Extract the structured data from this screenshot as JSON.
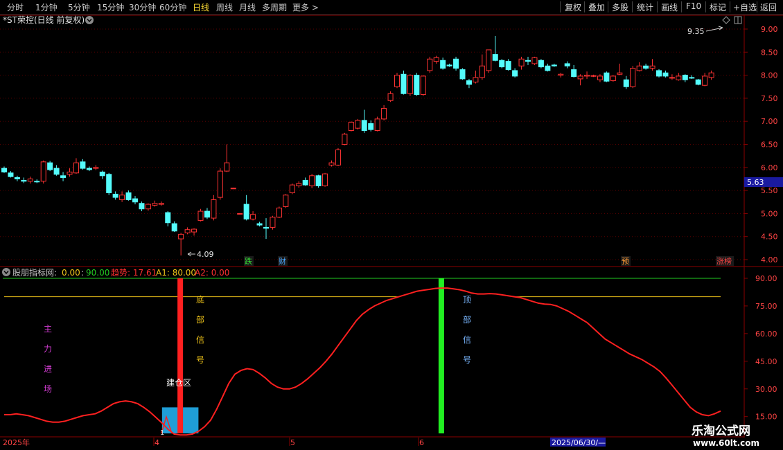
{
  "toolbar": {
    "periods": [
      "分时",
      "1分钟",
      "5分钟",
      "15分钟",
      "30分钟",
      "60分钟",
      "日线",
      "周线",
      "月线",
      "多周期",
      "更多 >"
    ],
    "active_period": "日线",
    "actions": [
      "复权",
      "叠加",
      "多股",
      "统计",
      "画线",
      "F10",
      "标记",
      "+自选",
      "返回"
    ]
  },
  "header": {
    "title": "*ST荣控(日线 前复权)",
    "icons": [
      "chevron-down-icon",
      "diamond-icon",
      "window-icon"
    ]
  },
  "price_axis": {
    "ticks": [
      "9.00",
      "8.50",
      "8.00",
      "7.50",
      "7.00",
      "6.50",
      "6.00",
      "5.50",
      "5.00",
      "4.50",
      "4.00"
    ],
    "current_price": "5.63",
    "high_label": "9.35",
    "low_label": "4.09"
  },
  "event_marks": [
    {
      "text": "跌",
      "color": "#33dd33"
    },
    {
      "text": "财",
      "color": "#4aa8ff"
    },
    {
      "text": "预",
      "color": "#ff9933"
    },
    {
      "text": "涨榜",
      "color": "#ff4444"
    }
  ],
  "indicator": {
    "name": "股朋指标网",
    "value_a": "0.00",
    "value_b": "90.00",
    "trend_label": "趋势: 17.61",
    "a1_label": "A1: 80.00",
    "a2_label": "A2: 0.00",
    "ticks": [
      "90.00",
      "75.00",
      "60.00",
      "45.00",
      "30.00",
      "15.00"
    ],
    "labels": {
      "main_entry": [
        "主",
        "力",
        "进",
        "场"
      ],
      "bottom_signal": [
        "底",
        "部",
        "信",
        "号"
      ],
      "top_signal": [
        "顶",
        "部",
        "信",
        "号"
      ],
      "build_zone": "建仓区",
      "small_mark": "1"
    }
  },
  "time_axis": {
    "labels": [
      "2025年",
      "4",
      "5",
      "6"
    ],
    "cursor_date": "2025/06/30/—"
  },
  "watermark": {
    "line1": "乐淘公式网",
    "line2": "www.60lt.com"
  },
  "colors": {
    "up": "#ff3333",
    "down": "#54fcfc",
    "trend_line": "#ff2020",
    "a1_line": "#f0c419",
    "upper_line": "#22cc22",
    "bottom_bar": "#ff2020",
    "top_bar": "#22ee22",
    "build_box": "#1f9ed6"
  },
  "chart_data": {
    "type": "candlestick",
    "price_ylim": [
      3.85,
      9.3
    ],
    "indicator_ylim": [
      4,
      96
    ],
    "candles": [
      {
        "o": 5.98,
        "h": 6.02,
        "l": 5.88,
        "c": 5.9
      },
      {
        "o": 5.88,
        "h": 5.92,
        "l": 5.78,
        "c": 5.8
      },
      {
        "o": 5.78,
        "h": 5.82,
        "l": 5.7,
        "c": 5.75
      },
      {
        "o": 5.72,
        "h": 5.78,
        "l": 5.66,
        "c": 5.7
      },
      {
        "o": 5.7,
        "h": 5.8,
        "l": 5.65,
        "c": 5.75
      },
      {
        "o": 5.7,
        "h": 5.74,
        "l": 5.66,
        "c": 5.69
      },
      {
        "o": 5.7,
        "h": 6.15,
        "l": 5.65,
        "c": 6.12
      },
      {
        "o": 6.1,
        "h": 6.14,
        "l": 5.92,
        "c": 5.95
      },
      {
        "o": 5.98,
        "h": 6.05,
        "l": 5.82,
        "c": 5.85
      },
      {
        "o": 5.82,
        "h": 5.9,
        "l": 5.7,
        "c": 5.78
      },
      {
        "o": 5.85,
        "h": 5.98,
        "l": 5.8,
        "c": 5.9
      },
      {
        "o": 5.88,
        "h": 6.2,
        "l": 5.86,
        "c": 6.1
      },
      {
        "o": 6.12,
        "h": 6.18,
        "l": 5.95,
        "c": 5.98
      },
      {
        "o": 5.98,
        "h": 6.02,
        "l": 5.92,
        "c": 5.95
      },
      {
        "o": 5.98,
        "h": 6.05,
        "l": 5.94,
        "c": 6.0
      },
      {
        "o": 5.9,
        "h": 5.93,
        "l": 5.75,
        "c": 5.82
      },
      {
        "o": 5.85,
        "h": 5.88,
        "l": 5.4,
        "c": 5.45
      },
      {
        "o": 5.42,
        "h": 5.48,
        "l": 5.3,
        "c": 5.35
      },
      {
        "o": 5.3,
        "h": 5.48,
        "l": 5.25,
        "c": 5.4
      },
      {
        "o": 5.45,
        "h": 5.5,
        "l": 5.28,
        "c": 5.3
      },
      {
        "o": 5.32,
        "h": 5.38,
        "l": 5.2,
        "c": 5.25
      },
      {
        "o": 5.22,
        "h": 5.26,
        "l": 5.05,
        "c": 5.1
      },
      {
        "o": 5.1,
        "h": 5.22,
        "l": 5.06,
        "c": 5.2
      },
      {
        "o": 5.18,
        "h": 5.28,
        "l": 5.15,
        "c": 5.22
      },
      {
        "o": 5.2,
        "h": 5.26,
        "l": 5.17,
        "c": 5.22
      },
      {
        "o": 5.02,
        "h": 5.05,
        "l": 4.72,
        "c": 4.8
      },
      {
        "o": 4.78,
        "h": 4.83,
        "l": 4.6,
        "c": 4.62
      },
      {
        "o": 4.45,
        "h": 4.58,
        "l": 4.09,
        "c": 4.55
      },
      {
        "o": 4.58,
        "h": 4.7,
        "l": 4.55,
        "c": 4.65
      },
      {
        "o": 4.6,
        "h": 4.68,
        "l": 4.52,
        "c": 4.66
      },
      {
        "o": 4.85,
        "h": 5.1,
        "l": 4.83,
        "c": 5.05
      },
      {
        "o": 5.05,
        "h": 5.12,
        "l": 4.88,
        "c": 4.92
      },
      {
        "o": 4.9,
        "h": 5.4,
        "l": 4.85,
        "c": 5.3
      },
      {
        "o": 5.35,
        "h": 5.98,
        "l": 5.3,
        "c": 5.92
      },
      {
        "o": 5.92,
        "h": 6.5,
        "l": 5.9,
        "c": 6.1
      },
      {
        "o": 5.55,
        "h": 5.56,
        "l": 5.54,
        "c": 5.55
      },
      {
        "o": 5.0,
        "h": 5.01,
        "l": 4.99,
        "c": 5.0
      },
      {
        "o": 5.2,
        "h": 5.4,
        "l": 4.85,
        "c": 4.88
      },
      {
        "o": 4.88,
        "h": 5.05,
        "l": 4.85,
        "c": 4.98
      },
      {
        "o": 4.78,
        "h": 4.82,
        "l": 4.72,
        "c": 4.75
      },
      {
        "o": 4.7,
        "h": 4.9,
        "l": 4.45,
        "c": 4.68
      },
      {
        "o": 4.7,
        "h": 4.95,
        "l": 4.65,
        "c": 4.92
      },
      {
        "o": 4.92,
        "h": 5.15,
        "l": 4.9,
        "c": 5.12
      },
      {
        "o": 5.15,
        "h": 5.42,
        "l": 5.12,
        "c": 5.4
      },
      {
        "o": 5.45,
        "h": 5.65,
        "l": 5.42,
        "c": 5.62
      },
      {
        "o": 5.6,
        "h": 5.7,
        "l": 5.56,
        "c": 5.65
      },
      {
        "o": 5.72,
        "h": 5.78,
        "l": 5.6,
        "c": 5.62
      },
      {
        "o": 5.6,
        "h": 5.86,
        "l": 5.55,
        "c": 5.82
      },
      {
        "o": 5.82,
        "h": 5.84,
        "l": 5.56,
        "c": 5.6
      },
      {
        "o": 5.6,
        "h": 5.88,
        "l": 5.58,
        "c": 5.86
      },
      {
        "o": 6.05,
        "h": 6.15,
        "l": 6.02,
        "c": 6.1
      },
      {
        "o": 6.05,
        "h": 6.42,
        "l": 6.03,
        "c": 6.38
      },
      {
        "o": 6.5,
        "h": 6.75,
        "l": 6.48,
        "c": 6.72
      },
      {
        "o": 6.8,
        "h": 7.0,
        "l": 6.78,
        "c": 6.98
      },
      {
        "o": 6.85,
        "h": 7.05,
        "l": 6.82,
        "c": 7.02
      },
      {
        "o": 7.02,
        "h": 7.25,
        "l": 6.75,
        "c": 6.8
      },
      {
        "o": 6.95,
        "h": 7.02,
        "l": 6.78,
        "c": 6.82
      },
      {
        "o": 6.8,
        "h": 7.1,
        "l": 6.78,
        "c": 7.05
      },
      {
        "o": 7.05,
        "h": 7.35,
        "l": 7.02,
        "c": 7.28
      },
      {
        "o": 7.45,
        "h": 7.65,
        "l": 7.42,
        "c": 7.6
      },
      {
        "o": 7.75,
        "h": 8.05,
        "l": 7.72,
        "c": 8.0
      },
      {
        "o": 8.02,
        "h": 8.1,
        "l": 7.58,
        "c": 7.6
      },
      {
        "o": 7.6,
        "h": 8.02,
        "l": 7.55,
        "c": 8.0
      },
      {
        "o": 8.0,
        "h": 8.05,
        "l": 7.55,
        "c": 7.58
      },
      {
        "o": 7.58,
        "h": 8.0,
        "l": 7.55,
        "c": 7.98
      },
      {
        "o": 8.1,
        "h": 8.4,
        "l": 8.05,
        "c": 8.35
      },
      {
        "o": 8.3,
        "h": 8.42,
        "l": 8.25,
        "c": 8.38
      },
      {
        "o": 8.32,
        "h": 8.38,
        "l": 8.12,
        "c": 8.15
      },
      {
        "o": 8.22,
        "h": 8.25,
        "l": 8.18,
        "c": 8.2
      },
      {
        "o": 8.35,
        "h": 8.4,
        "l": 8.1,
        "c": 8.15
      },
      {
        "o": 8.12,
        "h": 8.15,
        "l": 7.9,
        "c": 7.92
      },
      {
        "o": 7.88,
        "h": 7.92,
        "l": 7.72,
        "c": 7.8
      },
      {
        "o": 7.85,
        "h": 8.1,
        "l": 7.82,
        "c": 7.95
      },
      {
        "o": 7.95,
        "h": 8.45,
        "l": 7.9,
        "c": 8.2
      },
      {
        "o": 8.1,
        "h": 8.55,
        "l": 8.05,
        "c": 8.55
      },
      {
        "o": 8.45,
        "h": 8.85,
        "l": 8.3,
        "c": 8.32
      },
      {
        "o": 8.32,
        "h": 8.35,
        "l": 8.15,
        "c": 8.18
      },
      {
        "o": 8.3,
        "h": 8.35,
        "l": 8.1,
        "c": 8.12
      },
      {
        "o": 8.1,
        "h": 8.15,
        "l": 7.95,
        "c": 7.98
      },
      {
        "o": 8.2,
        "h": 8.4,
        "l": 8.12,
        "c": 8.35
      },
      {
        "o": 8.32,
        "h": 8.4,
        "l": 8.22,
        "c": 8.3
      },
      {
        "o": 8.25,
        "h": 8.4,
        "l": 8.22,
        "c": 8.38
      },
      {
        "o": 8.32,
        "h": 8.35,
        "l": 8.15,
        "c": 8.18
      },
      {
        "o": 8.2,
        "h": 8.25,
        "l": 8.08,
        "c": 8.1
      },
      {
        "o": 8.22,
        "h": 8.25,
        "l": 8.18,
        "c": 8.2
      },
      {
        "o": 8.0,
        "h": 8.05,
        "l": 7.95,
        "c": 8.02
      },
      {
        "o": 8.25,
        "h": 8.3,
        "l": 8.15,
        "c": 8.2
      },
      {
        "o": 8.12,
        "h": 8.22,
        "l": 7.95,
        "c": 7.97
      },
      {
        "o": 7.92,
        "h": 8.02,
        "l": 7.78,
        "c": 7.98
      },
      {
        "o": 7.98,
        "h": 8.08,
        "l": 7.92,
        "c": 8.0
      },
      {
        "o": 7.98,
        "h": 8.01,
        "l": 7.96,
        "c": 7.99
      },
      {
        "o": 7.9,
        "h": 8.02,
        "l": 7.85,
        "c": 7.98
      },
      {
        "o": 8.05,
        "h": 8.08,
        "l": 7.85,
        "c": 7.87
      },
      {
        "o": 7.88,
        "h": 8.0,
        "l": 7.86,
        "c": 7.98
      },
      {
        "o": 8.02,
        "h": 8.25,
        "l": 8.0,
        "c": 8.05
      },
      {
        "o": 7.9,
        "h": 7.98,
        "l": 7.7,
        "c": 7.75
      },
      {
        "o": 7.75,
        "h": 8.2,
        "l": 7.72,
        "c": 8.15
      },
      {
        "o": 8.1,
        "h": 8.28,
        "l": 8.08,
        "c": 8.2
      },
      {
        "o": 8.2,
        "h": 8.25,
        "l": 8.12,
        "c": 8.15
      },
      {
        "o": 8.15,
        "h": 8.35,
        "l": 8.1,
        "c": 8.2
      },
      {
        "o": 8.1,
        "h": 8.13,
        "l": 7.95,
        "c": 7.98
      },
      {
        "o": 8.05,
        "h": 8.1,
        "l": 7.95,
        "c": 7.98
      },
      {
        "o": 7.95,
        "h": 8.02,
        "l": 7.9,
        "c": 7.95
      },
      {
        "o": 7.9,
        "h": 8.05,
        "l": 7.88,
        "c": 7.98
      },
      {
        "o": 8.0,
        "h": 8.02,
        "l": 7.85,
        "c": 7.9
      },
      {
        "o": 7.95,
        "h": 8.0,
        "l": 7.92,
        "c": 7.94
      },
      {
        "o": 7.9,
        "h": 7.92,
        "l": 7.78,
        "c": 7.8
      },
      {
        "o": 7.78,
        "h": 8.05,
        "l": 7.76,
        "c": 7.98
      },
      {
        "o": 7.95,
        "h": 8.1,
        "l": 7.9,
        "c": 8.05
      }
    ],
    "trend": [
      16,
      16,
      16.5,
      16,
      15.5,
      14.5,
      13.5,
      12.5,
      12,
      12,
      12.5,
      13.5,
      14.5,
      15.5,
      16,
      16.5,
      18,
      20,
      22,
      23,
      23.5,
      23,
      22,
      20,
      17.5,
      14.5,
      11.5,
      8,
      5.5,
      5,
      5,
      5.5,
      7,
      9.5,
      13,
      19,
      26,
      33,
      38,
      40,
      41,
      40.5,
      38.5,
      36,
      33,
      31,
      30,
      30,
      31,
      33,
      35.5,
      38.5,
      41.5,
      45,
      49,
      53.5,
      58,
      62.5,
      67,
      70.5,
      73,
      75,
      76.5,
      78,
      79,
      80,
      81,
      82,
      83,
      83.5,
      84,
      84.5,
      84.7,
      84.7,
      84.3,
      83.8,
      83,
      82,
      81.5,
      81.5,
      81.7,
      81.5,
      81,
      80.5,
      80,
      79.5,
      78.5,
      77.5,
      76.5,
      76,
      75.8,
      75,
      73.5,
      72,
      70,
      68,
      66,
      63,
      60,
      57,
      55,
      53,
      51,
      49,
      47.5,
      46,
      44,
      42,
      39.5,
      36,
      32,
      28,
      24,
      20,
      17.5,
      16,
      15.5,
      16.5,
      18
    ],
    "a1": 80,
    "upper": 90,
    "bottom_signal_index": 29,
    "top_signal_index": 72,
    "build_zone_range": [
      26,
      32
    ]
  }
}
